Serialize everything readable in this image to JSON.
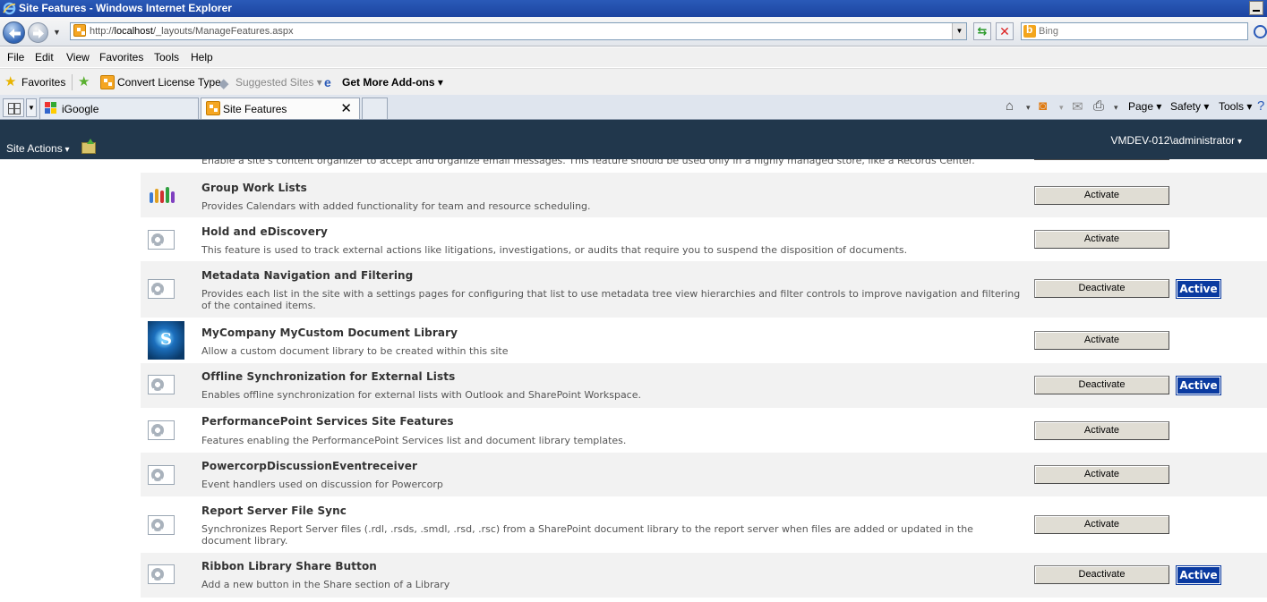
{
  "window": {
    "title": "Site Features - Windows Internet Explorer"
  },
  "address_bar": {
    "url_prefix": "http://",
    "url_host": "localhost",
    "url_path": "/_layouts/ManageFeatures.aspx",
    "search_placeholder": "Bing"
  },
  "menu": [
    "File",
    "Edit",
    "View",
    "Favorites",
    "Tools",
    "Help"
  ],
  "favorites_bar": {
    "favorites_label": "Favorites",
    "items": [
      "Convert License Type",
      "Suggested Sites ▾",
      "Get More Add-ons ▾"
    ]
  },
  "tabs": [
    {
      "label": "iGoogle",
      "active": false
    },
    {
      "label": "Site Features",
      "active": true
    }
  ],
  "command_bar": [
    "Page ▾",
    "Safety ▾",
    "Tools ▾"
  ],
  "sharepoint": {
    "site_actions": "Site Actions",
    "user": "VMDEV-012\\administrator"
  },
  "partial_row_text": "Enable a site's content organizer to accept and organize email messages. This feature should be used only in a highly managed store, like a Records Center.",
  "features": [
    {
      "title": "Group Work Lists",
      "description": "Provides Calendars with added functionality for team and resource scheduling.",
      "button": "Activate",
      "status": "",
      "icon": "group-work-icon"
    },
    {
      "title": "Hold and eDiscovery",
      "description": "This feature is used to track external actions like litigations, investigations, or audits that require you to suspend the disposition of documents.",
      "button": "Activate",
      "status": "",
      "icon": "feature-gear-icon"
    },
    {
      "title": "Metadata Navigation and Filtering",
      "description": "Provides each list in the site with a settings pages for configuring that list to use metadata tree view hierarchies and filter controls to improve navigation and filtering of the contained items.",
      "button": "Deactivate",
      "status": "Active",
      "icon": "feature-gear-icon"
    },
    {
      "title": "MyCompany MyCustom Document Library",
      "description": "Allow a custom document library to be created within this site",
      "button": "Activate",
      "status": "",
      "icon": "custom-library-icon"
    },
    {
      "title": "Offline Synchronization for External Lists",
      "description": "Enables offline synchronization for external lists with Outlook and SharePoint Workspace.",
      "button": "Deactivate",
      "status": "Active",
      "icon": "feature-gear-icon"
    },
    {
      "title": "PerformancePoint Services Site Features",
      "description": "Features enabling the PerformancePoint Services list and document library templates.",
      "button": "Activate",
      "status": "",
      "icon": "feature-gear-icon"
    },
    {
      "title": "PowercorpDiscussionEventreceiver",
      "description": "Event handlers used on discussion for Powercorp",
      "button": "Activate",
      "status": "",
      "icon": "feature-gear-icon"
    },
    {
      "title": "Report Server File Sync",
      "description": "Synchronizes Report Server files (.rdl, .rsds, .smdl, .rsd, .rsc) from a SharePoint document library to the report server when files are added or updated in the document library.",
      "button": "Activate",
      "status": "",
      "icon": "feature-gear-icon"
    },
    {
      "title": "Ribbon Library Share Button",
      "description": "Add a new button in the Share section of a Library",
      "button": "Deactivate",
      "status": "Active",
      "icon": "feature-gear-icon"
    }
  ]
}
